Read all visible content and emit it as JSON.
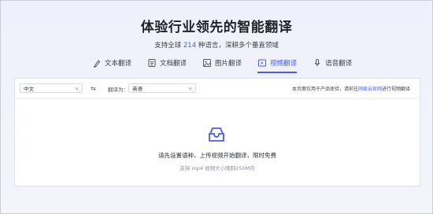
{
  "hero": {
    "title": "体验行业领先的智能翻译",
    "subtitle_prefix": "支持全球",
    "subtitle_count": "214",
    "subtitle_suffix": "种语言，深耕多个垂直领域"
  },
  "tabs": [
    {
      "label": "文本翻译",
      "icon": "text-translate-icon",
      "active": false
    },
    {
      "label": "文档翻译",
      "icon": "document-icon",
      "active": false
    },
    {
      "label": "图片翻译",
      "icon": "image-icon",
      "active": false
    },
    {
      "label": "视频翻译",
      "icon": "video-icon",
      "active": true
    },
    {
      "label": "语音翻译",
      "icon": "microphone-icon",
      "active": false
    }
  ],
  "toolbar": {
    "source_language": "中文",
    "swap_symbol": "⇆",
    "target_label": "翻译为：",
    "target_language": "英语",
    "notice_prefix": "本页面仅用于产品体验，请前往",
    "notice_link": "网易云官网",
    "notice_suffix": "进行视频翻译"
  },
  "upload": {
    "main_text": "请先设置语种，上传视频开始翻译，限时免费",
    "hint_text": "支持 mp4 视频大小限制250M内"
  },
  "colors": {
    "accent": "#4a5cf0",
    "background": "#f5f6fb"
  }
}
